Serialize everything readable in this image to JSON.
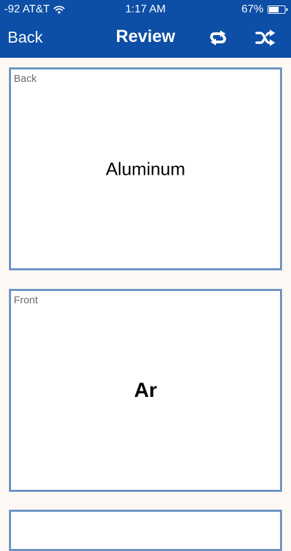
{
  "status_bar": {
    "carrier": "-92 AT&T",
    "time": "1:17 AM",
    "battery_percent": "67%",
    "battery_level": 0.67
  },
  "nav": {
    "back_label": "Back",
    "title": "Review"
  },
  "cards": [
    {
      "side_label": "Back",
      "text": "Aluminum"
    },
    {
      "side_label": "Front",
      "text": "Ar"
    }
  ],
  "colors": {
    "header_bg": "#0d4ea6",
    "card_border": "#6a93c4",
    "page_bg": "#fdf8f3"
  },
  "icons": {
    "wifi": "wifi-icon",
    "battery": "battery-icon",
    "repeat": "repeat-icon",
    "shuffle": "shuffle-icon"
  }
}
